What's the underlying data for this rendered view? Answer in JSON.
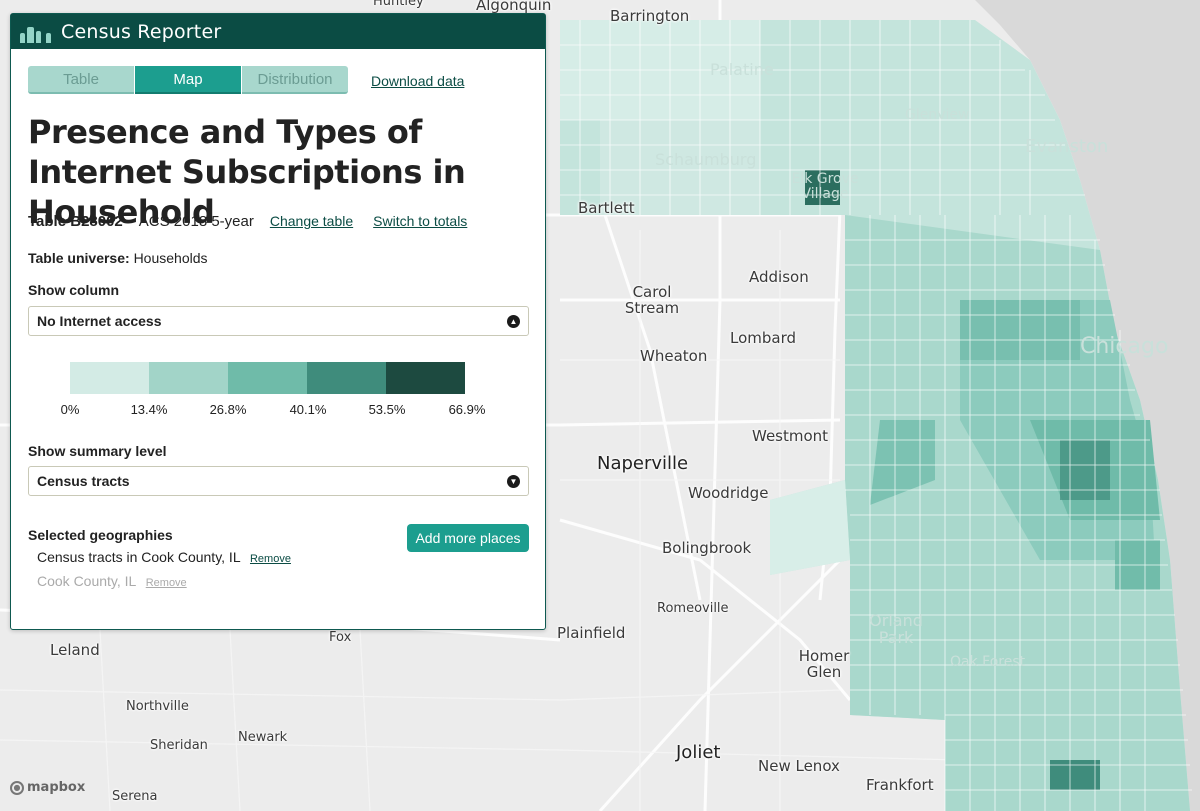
{
  "app": {
    "name": "Census Reporter"
  },
  "tabs": [
    {
      "label": "Table",
      "active": false
    },
    {
      "label": "Map",
      "active": true
    },
    {
      "label": "Distribution",
      "active": false
    }
  ],
  "download_label": "Download data",
  "title": "Presence and Types of Internet Subscriptions in Household",
  "meta": {
    "table_id": "Table B28002",
    "release": "ACS 2018 5-year",
    "change_table": "Change table",
    "switch_totals": "Switch to totals"
  },
  "universe": {
    "label": "Table universe:",
    "value": "Households"
  },
  "show_column": {
    "label": "Show column",
    "selected": "No Internet access"
  },
  "legend": {
    "breaks": [
      "0%",
      "13.4%",
      "26.8%",
      "40.1%",
      "53.5%",
      "66.9%"
    ],
    "colors": [
      "#d3ebe5",
      "#a2d4c8",
      "#6fbba9",
      "#3f8c7c",
      "#1d4a40"
    ]
  },
  "summary_level": {
    "label": "Show summary level",
    "selected": "Census tracts"
  },
  "selected_geographies": {
    "label": "Selected geographies",
    "add_button": "Add more places",
    "items": [
      {
        "name": "Census tracts in Cook County, IL",
        "remove": "Remove",
        "active": true
      },
      {
        "name": "Cook County, IL",
        "remove": "Remove",
        "active": false
      }
    ]
  },
  "map": {
    "attribution": "mapbox",
    "places": [
      "Huntley",
      "Algonquin",
      "Barrington",
      "Palatine",
      "Schaumburg",
      "Elk Grove Village",
      "Bartlett",
      "Evanston",
      "Glenview",
      "Addison",
      "Carol Stream",
      "Lombard",
      "Wheaton",
      "Chicago",
      "Naperville",
      "Westmont",
      "Woodridge",
      "Bolingbrook",
      "Romeoville",
      "Plainfield",
      "Orland Park",
      "Oak Forest",
      "Homer Glen",
      "Joliet",
      "New Lenox",
      "Frankfort",
      "Leland",
      "Northville",
      "Sheridan",
      "Newark",
      "Serena",
      "Fox"
    ]
  }
}
